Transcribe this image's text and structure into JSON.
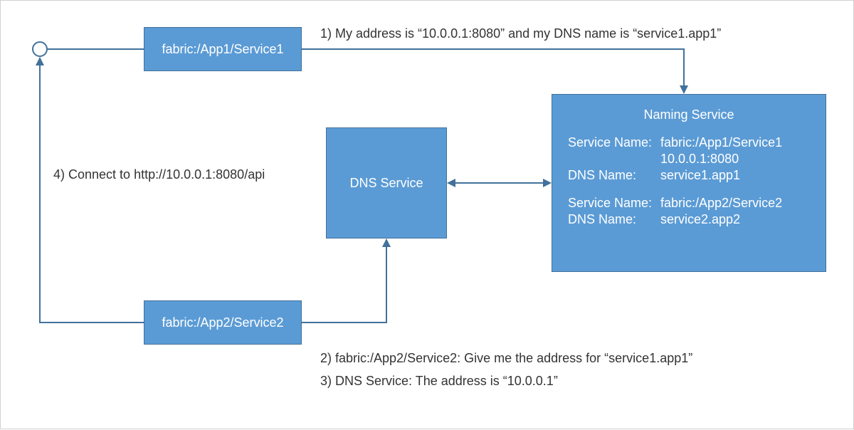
{
  "boxes": {
    "service1": "fabric:/App1/Service1",
    "dns": "DNS Service",
    "service2": "fabric:/App2/Service2"
  },
  "naming": {
    "title": "Naming Service",
    "entries": [
      {
        "service_name_label": "Service Name:",
        "service_name": "fabric:/App1/Service1",
        "address": "10.0.0.1:8080",
        "dns_name_label": "DNS Name:",
        "dns_name": "service1.app1"
      },
      {
        "service_name_label": "Service Name:",
        "service_name": "fabric:/App2/Service2",
        "dns_name_label": "DNS Name:",
        "dns_name": "service2.app2"
      }
    ]
  },
  "steps": {
    "s1": "1) My address is “10.0.0.1:8080” and my DNS name is “service1.app1”",
    "s2": "2) fabric:/App2/Service2: Give me the address for “service1.app1”",
    "s3": "3) DNS Service: The address is “10.0.0.1”",
    "s4": "4) Connect to http://10.0.0.1:8080/api"
  },
  "colors": {
    "box_fill": "#5b9bd5",
    "box_border": "#41719c",
    "text_dark": "#333333"
  }
}
